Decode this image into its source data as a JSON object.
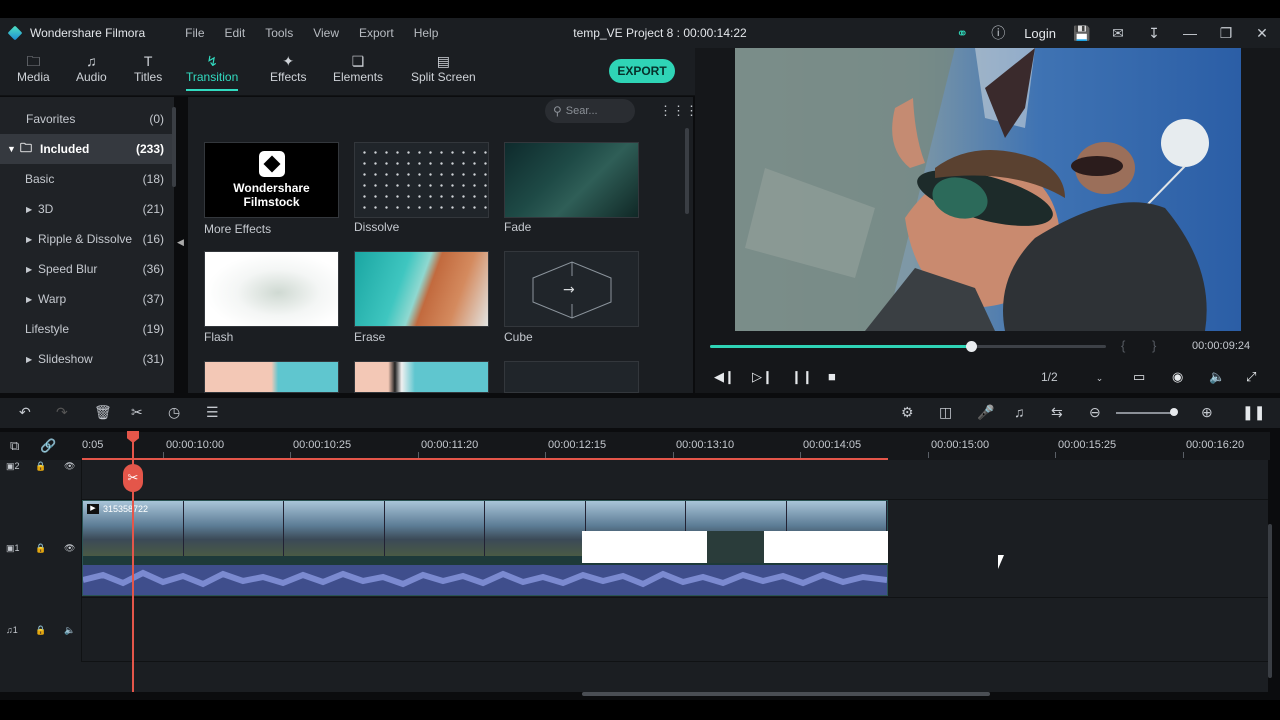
{
  "app": {
    "name": "Wondershare Filmora",
    "title": "temp_VE Project 8 : 00:00:14:22",
    "login": "Login"
  },
  "menu": [
    "File",
    "Edit",
    "Tools",
    "View",
    "Export",
    "Help"
  ],
  "toolbar": {
    "tabs": [
      {
        "label": "Media",
        "icon": "folder-icon"
      },
      {
        "label": "Audio",
        "icon": "music-note-icon"
      },
      {
        "label": "Titles",
        "icon": "text-icon"
      },
      {
        "label": "Transition",
        "icon": "transition-icon",
        "active": true
      },
      {
        "label": "Effects",
        "icon": "sparkle-icon"
      },
      {
        "label": "Elements",
        "icon": "elements-icon"
      },
      {
        "label": "Split Screen",
        "icon": "split-screen-icon"
      }
    ],
    "export_label": "EXPORT"
  },
  "sidebar": {
    "items": [
      {
        "label": "Favorites",
        "count": "(0)"
      },
      {
        "label": "Included",
        "count": "(233)",
        "selected": true
      },
      {
        "label": "Basic",
        "count": "(18)"
      },
      {
        "label": "3D",
        "count": "(21)"
      },
      {
        "label": "Ripple & Dissolve",
        "count": "(16)"
      },
      {
        "label": "Speed Blur",
        "count": "(36)"
      },
      {
        "label": "Warp",
        "count": "(37)"
      },
      {
        "label": "Lifestyle",
        "count": "(19)"
      },
      {
        "label": "Slideshow",
        "count": "(31)"
      }
    ]
  },
  "media": {
    "search_placeholder": "Sear...",
    "items": [
      {
        "label": "More Effects",
        "thumb_text": "Wondershare\nFilmstock"
      },
      {
        "label": "Dissolve"
      },
      {
        "label": "Fade"
      },
      {
        "label": "Flash"
      },
      {
        "label": "Erase"
      },
      {
        "label": "Cube"
      }
    ]
  },
  "preview": {
    "progress": 0.66,
    "time": "00:00:09:24",
    "ratio": "1/2",
    "brace_open": "{",
    "brace_close": "}"
  },
  "timeline": {
    "ruler": [
      "0:05",
      "00:00:10:00",
      "00:00:10:25",
      "00:00:11:20",
      "00:00:12:15",
      "00:00:13:10",
      "00:00:14:05",
      "00:00:15:00",
      "00:00:15:25",
      "00:00:16:20"
    ],
    "tracks": [
      {
        "label": "2"
      },
      {
        "label": "1"
      },
      {
        "label": "1"
      }
    ],
    "clip_name": "315358722"
  },
  "colors": {
    "accent": "#2fd4b6",
    "playhead": "#e4564a"
  }
}
